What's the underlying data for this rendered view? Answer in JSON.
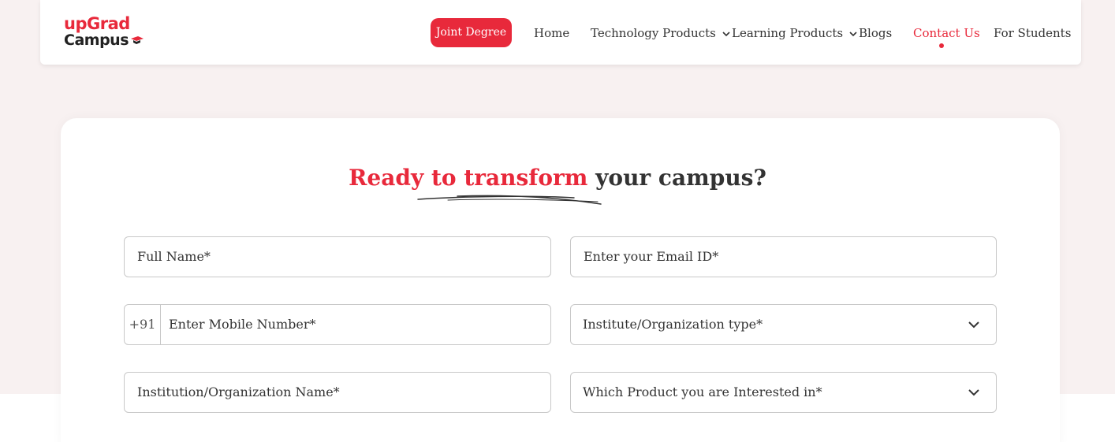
{
  "brand": {
    "logo_top": "upGrad",
    "logo_bottom": "Campus",
    "primary_color": "#e8293b"
  },
  "nav": {
    "cta": "Joint Degree",
    "items": [
      {
        "label": "Home"
      },
      {
        "label": "Technology Products",
        "has_dropdown": true
      },
      {
        "label": "Learning Products",
        "has_dropdown": true
      },
      {
        "label": "Blogs"
      },
      {
        "label": "Contact Us",
        "active": true
      },
      {
        "label": "For Students"
      }
    ]
  },
  "form": {
    "heading_accent": "Ready to transform",
    "heading_rest": " your campus?",
    "full_name": "Full Name*",
    "email": "Enter your Email ID*",
    "phone_prefix": "+91",
    "mobile": "Enter Mobile Number*",
    "institute_type": "Institute/Organization type*",
    "institution_name": "Institution/Organization Name*",
    "product_interest": "Which Product you are Interested in*"
  }
}
